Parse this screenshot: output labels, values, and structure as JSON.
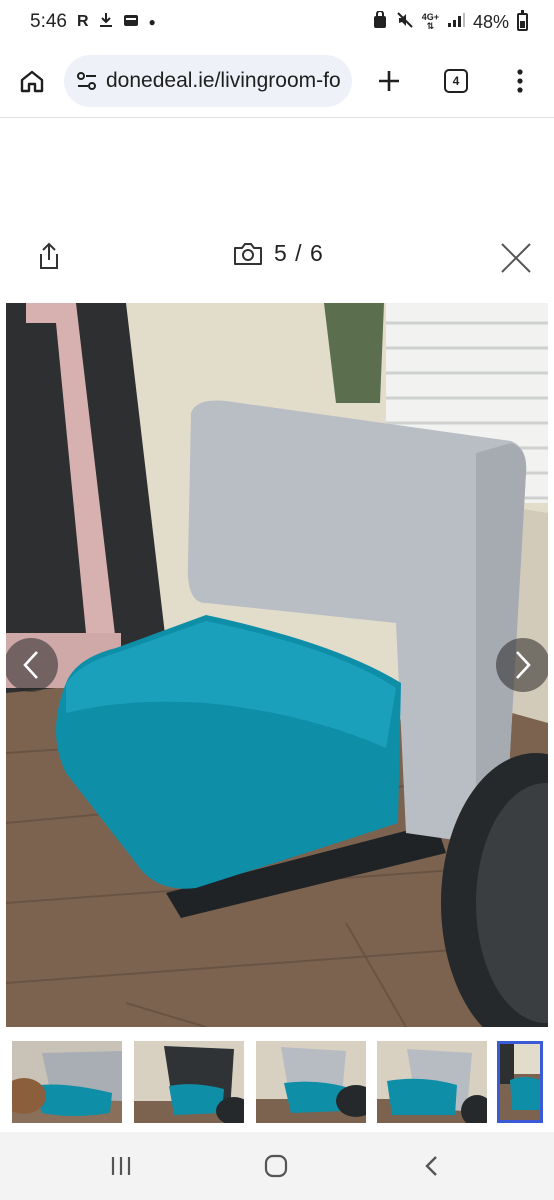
{
  "status_bar": {
    "time": "5:46",
    "left_icons": [
      "r-app-icon",
      "download-icon",
      "wallet-icon",
      "dot-icon"
    ],
    "r_glyph": "R",
    "network_top": "4G+",
    "battery_text": "48%",
    "battery_level": 0.48
  },
  "browser": {
    "url": "donedeal.ie/livingroom-fo",
    "tab_count": "4"
  },
  "gallery": {
    "counter": "5 / 6",
    "current_index": 5,
    "total": 6
  },
  "thumbnails": [
    {
      "id": "thumb-1",
      "active": false
    },
    {
      "id": "thumb-2",
      "active": false
    },
    {
      "id": "thumb-3",
      "active": false
    },
    {
      "id": "thumb-4",
      "active": false
    },
    {
      "id": "thumb-5",
      "active": true
    }
  ],
  "colors": {
    "accent": "#3b5bd6",
    "seat_teal": "#0f8ea8",
    "back_grey": "#b7bcc3",
    "floor": "#7a6452"
  }
}
